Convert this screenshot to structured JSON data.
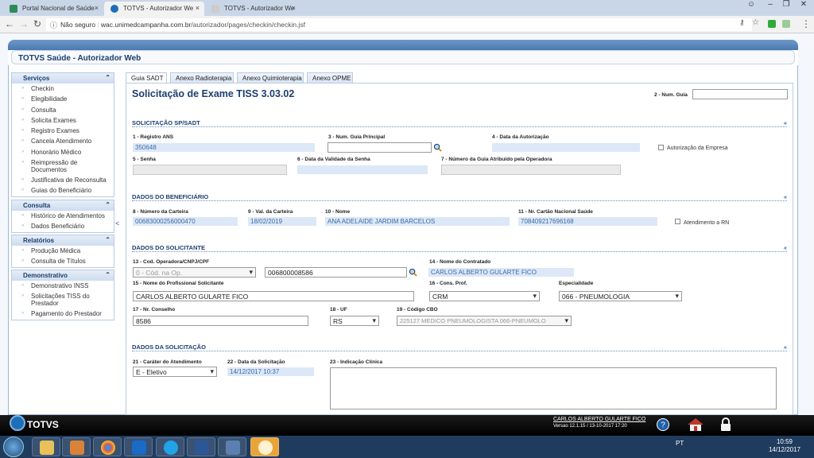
{
  "browser": {
    "tabs": [
      {
        "label": "Portal Nacional de Saúde",
        "active": false
      },
      {
        "label": "TOTVS - Autorizador We",
        "active": true
      },
      {
        "label": "TOTVS - Autorizador We",
        "active": false
      }
    ],
    "security": "Não seguro",
    "url_host": "wac.unimedcampanha.com.br",
    "url_path": "/autorizador/pages/checkin/checkin.jsf"
  },
  "app": {
    "title": "TOTVS Saúde - Autorizador Web"
  },
  "sidebar": {
    "collapse_glyph": "<",
    "sections": [
      {
        "title": "Serviços",
        "items": [
          "Checkin",
          "Elegibilidade",
          "Consulta",
          "Solicita Exames",
          "Registro Exames",
          "Cancela Atendimento",
          "Honorário Médico",
          "Reimpressão de Documentos",
          "Justificativa de Reconsulta",
          "Guias do Beneficiário"
        ]
      },
      {
        "title": "Consulta",
        "items": [
          "Histórico de Atendimentos",
          "Dados Beneficiário"
        ]
      },
      {
        "title": "Relatórios",
        "items": [
          "Produção Médica",
          "Consulta de Títulos"
        ]
      },
      {
        "title": "Demonstrativo",
        "items": [
          "Demonstrativo INSS",
          "Solicitações TISS do Prestador",
          "Pagamento do Prestador"
        ]
      }
    ]
  },
  "content_tabs": [
    "Guia SADT",
    "Anexo Radioterapia",
    "Anexo Quimioterapia",
    "Anexo OPME"
  ],
  "form": {
    "title": "Solicitação de Exame TISS 3.03.02",
    "num_guia_label": "2 - Num. Guia",
    "sections": {
      "sp": "SOLICITAÇÃO SP/SADT",
      "benef": "DADOS DO BENEFICIÁRIO",
      "solic": "DADOS DO SOLICITANTE",
      "solicitacao": "DADOS DA SOLICITAÇÃO",
      "collapse": "«"
    },
    "registro_ans_label": "1 - Registro ANS",
    "registro_ans": "350648",
    "guia_principal_label": "3 - Num. Guia Principal",
    "data_autorizacao_label": "4 - Data da Autorização",
    "autorizacao_empresa_label": "Autorização da Empresa",
    "senha_label": "5 - Senha",
    "validade_senha_label": "6 - Data da Validade da Senha",
    "guia_operadora_label": "7 - Número da Guia Atribuído pela Operadora",
    "carteira_label": "8 - Número da Carteira",
    "carteira": "00683000256000470",
    "val_carteira_label": "9 - Val. da Carteira",
    "val_carteira": "18/02/2019",
    "nome_label": "10 - Nome",
    "nome": "ANA ADELAIDE JARDIM BARCELOS",
    "cns_label": "11 - Nr. Cartão Nacional Saúde",
    "cns": "708409217696168",
    "atendimento_rn_label": "Atendimento a RN",
    "cod_operadora_label": "13 - Cod. Operadora/CNPJ/CPF",
    "cod_operadora_select": "0 - Cód. na Op.",
    "cod_operadora": "006800008586",
    "contratado_label": "14 - Nome do Contratado",
    "contratado": "CARLOS ALBERTO GULARTE FICO",
    "profissional_label": "15 - Nome do Profissional Solicitante",
    "profissional": "CARLOS ALBERTO GULARTE FICO",
    "cons_prof_label": "16 - Cons. Prof.",
    "cons_prof": "CRM",
    "especialidade_label": "Especialidade",
    "especialidade": "066 - PNEUMOLOGIA",
    "nr_conselho_label": "17 - Nr. Conselho",
    "nr_conselho": "8586",
    "uf_label": "18 - UF",
    "uf": "RS",
    "cbo_label": "19 - Código CBO",
    "cbo": "225127 MEDICO PNEUMOLOGISTA 066-PNEUMOLO",
    "carater_label": "21 - Caráter do Atendimento",
    "carater": "E - Eletivo",
    "data_solicitacao_label": "22 - Data da Solicitação",
    "data_solicitacao": "14/12/2017 10:37",
    "indicacao_label": "23 - Indicação Clínica"
  },
  "footer": {
    "brand": "TOTVS",
    "user": "CARLOS ALBERTO GULARTE FICO",
    "version": "Versao 12.1.15 / 13-10-2017 17:20"
  },
  "taskbar": {
    "lang": "PT",
    "time": "10:59",
    "date": "14/12/2017"
  },
  "colors": {
    "brand": "#1c3e6e",
    "readonly_bg": "#dce8f7",
    "readonly_text": "#3a6aa8"
  }
}
